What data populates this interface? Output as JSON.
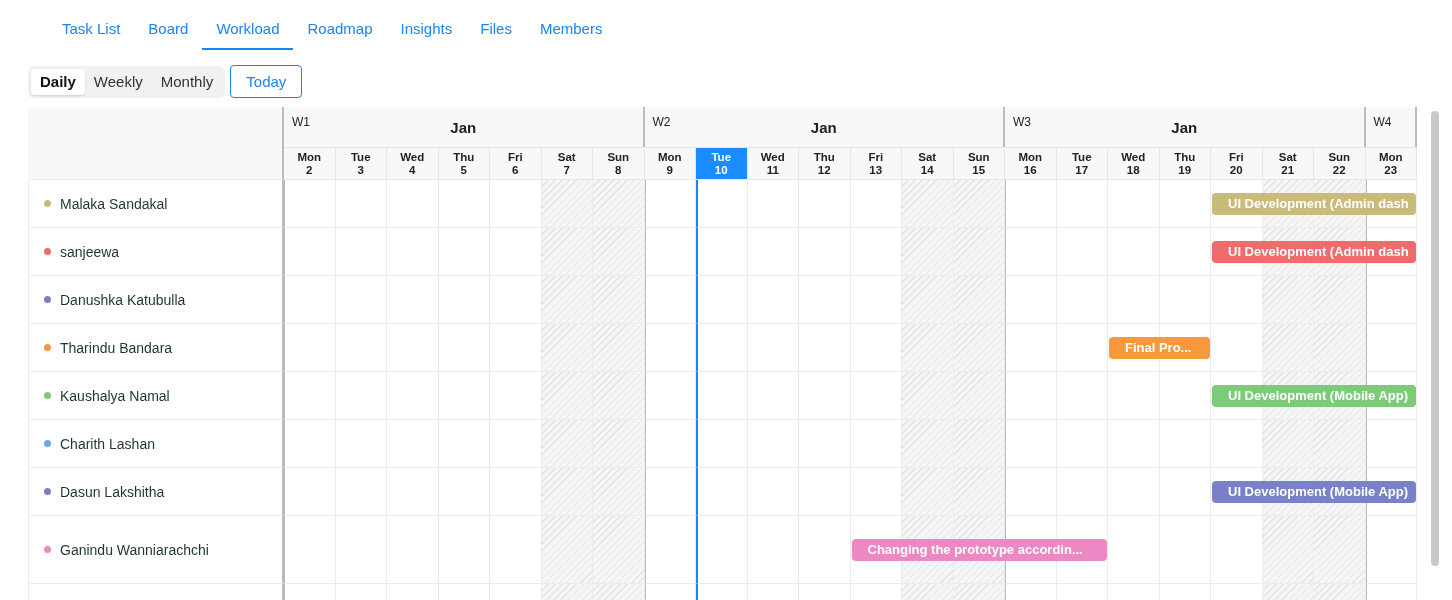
{
  "tabs": [
    {
      "label": "Task List",
      "selected": false
    },
    {
      "label": "Board",
      "selected": false
    },
    {
      "label": "Workload",
      "selected": true
    },
    {
      "label": "Roadmap",
      "selected": false
    },
    {
      "label": "Insights",
      "selected": false
    },
    {
      "label": "Files",
      "selected": false
    },
    {
      "label": "Members",
      "selected": false
    }
  ],
  "view_modes": [
    {
      "label": "Daily",
      "selected": true
    },
    {
      "label": "Weekly",
      "selected": false
    },
    {
      "label": "Monthly",
      "selected": false
    }
  ],
  "today_button": "Today",
  "weeks": [
    {
      "label": "W1",
      "month": "Jan",
      "days": [
        {
          "weekday": "Mon",
          "date": "2",
          "weekend": false,
          "selected": false
        },
        {
          "weekday": "Tue",
          "date": "3",
          "weekend": false,
          "selected": false
        },
        {
          "weekday": "Wed",
          "date": "4",
          "weekend": false,
          "selected": false
        },
        {
          "weekday": "Thu",
          "date": "5",
          "weekend": false,
          "selected": false
        },
        {
          "weekday": "Fri",
          "date": "6",
          "weekend": false,
          "selected": false
        },
        {
          "weekday": "Sat",
          "date": "7",
          "weekend": true,
          "selected": false
        },
        {
          "weekday": "Sun",
          "date": "8",
          "weekend": true,
          "selected": false
        }
      ]
    },
    {
      "label": "W2",
      "month": "Jan",
      "days": [
        {
          "weekday": "Mon",
          "date": "9",
          "weekend": false,
          "selected": false
        },
        {
          "weekday": "Tue",
          "date": "10",
          "weekend": false,
          "selected": true
        },
        {
          "weekday": "Wed",
          "date": "11",
          "weekend": false,
          "selected": false
        },
        {
          "weekday": "Thu",
          "date": "12",
          "weekend": false,
          "selected": false
        },
        {
          "weekday": "Fri",
          "date": "13",
          "weekend": false,
          "selected": false
        },
        {
          "weekday": "Sat",
          "date": "14",
          "weekend": true,
          "selected": false
        },
        {
          "weekday": "Sun",
          "date": "15",
          "weekend": true,
          "selected": false
        }
      ]
    },
    {
      "label": "W3",
      "month": "Jan",
      "days": [
        {
          "weekday": "Mon",
          "date": "16",
          "weekend": false,
          "selected": false
        },
        {
          "weekday": "Tue",
          "date": "17",
          "weekend": false,
          "selected": false
        },
        {
          "weekday": "Wed",
          "date": "18",
          "weekend": false,
          "selected": false
        },
        {
          "weekday": "Thu",
          "date": "19",
          "weekend": false,
          "selected": false
        },
        {
          "weekday": "Fri",
          "date": "20",
          "weekend": false,
          "selected": false
        },
        {
          "weekday": "Sat",
          "date": "21",
          "weekend": true,
          "selected": false
        },
        {
          "weekday": "Sun",
          "date": "22",
          "weekend": true,
          "selected": false
        }
      ]
    },
    {
      "label": "W4",
      "days": [
        {
          "weekday": "Mon",
          "date": "23",
          "weekend": false,
          "selected": false
        }
      ]
    }
  ],
  "members": [
    {
      "name": "Malaka Sandakal",
      "color": "#c9bb78",
      "tasks": [
        {
          "label": "UI Development (Admin dash"
        }
      ]
    },
    {
      "name": "sanjeewa",
      "color": "#f06b6b",
      "tasks": [
        {
          "label": "UI Development (Admin dash"
        }
      ]
    },
    {
      "name": "Danushka Katubulla",
      "color": "#7a80c9"
    },
    {
      "name": "Tharindu Bandara",
      "color": "#f7993a",
      "tasks": [
        {
          "label": "Final Pro..."
        }
      ]
    },
    {
      "name": "Kaushalya Namal",
      "color": "#7ccb78",
      "tasks": [
        {
          "label": "UI Development (Mobile App)"
        }
      ]
    },
    {
      "name": "Charith Lashan",
      "color": "#6ea6ee"
    },
    {
      "name": "Dasun Lakshitha",
      "color": "#7a80c9",
      "tasks": [
        {
          "label": "UI Development (Mobile App)"
        }
      ]
    },
    {
      "name": "Ganindu Wanniarachchi",
      "color": "#ee88c4",
      "tasks": [
        {
          "label": "Changing the prototype accordin..."
        }
      ]
    }
  ]
}
